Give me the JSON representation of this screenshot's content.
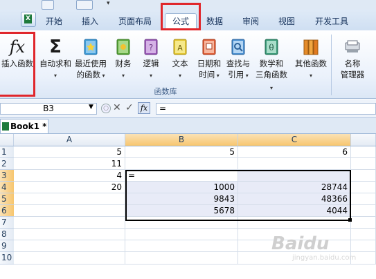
{
  "ribbon": {
    "tabs": [
      "开始",
      "插入",
      "页面布局",
      "公式",
      "数据",
      "审阅",
      "视图",
      "开发工具"
    ],
    "active_tab": "公式",
    "buttons": {
      "insert_function": "插入函数",
      "autosum_1": "自动求和",
      "recent_1": "最近使用",
      "recent_2": "的函数",
      "financial": "财务",
      "logical": "逻辑",
      "text": "文本",
      "datetime_1": "日期和",
      "datetime_2": "时间",
      "lookup_1": "查找与",
      "lookup_2": "引用",
      "math_1": "数学和",
      "math_2": "三角函数",
      "other": "其他函数",
      "name_mgr_1": "名称",
      "name_mgr_2": "管理器"
    },
    "group_label": "函数库",
    "icons": {
      "insert_function": "fx",
      "autosum": "Σ"
    }
  },
  "formula_bar": {
    "name_box": "B3",
    "fx_label": "fx",
    "content": "="
  },
  "workbook": {
    "tab_label": "Book1 *"
  },
  "grid": {
    "columns": [
      "A",
      "B",
      "C"
    ],
    "rows": [
      "1",
      "2",
      "3",
      "4",
      "5",
      "6",
      "7",
      "8",
      "9",
      "10"
    ],
    "cells": {
      "A1": "5",
      "B1": "5",
      "C1": "6",
      "A2": "11",
      "A3": "4",
      "B3": "=",
      "A4": "20",
      "B4": "1000",
      "C4": "28744",
      "B5": "9843",
      "C5": "48366",
      "B6": "5678",
      "C6": "4044"
    }
  },
  "watermark": {
    "main": "Baidu",
    "sub": "jingyan.baidu.com"
  },
  "colors": {
    "highlight": "#e0262b",
    "selection_header": "#f7c66f"
  }
}
